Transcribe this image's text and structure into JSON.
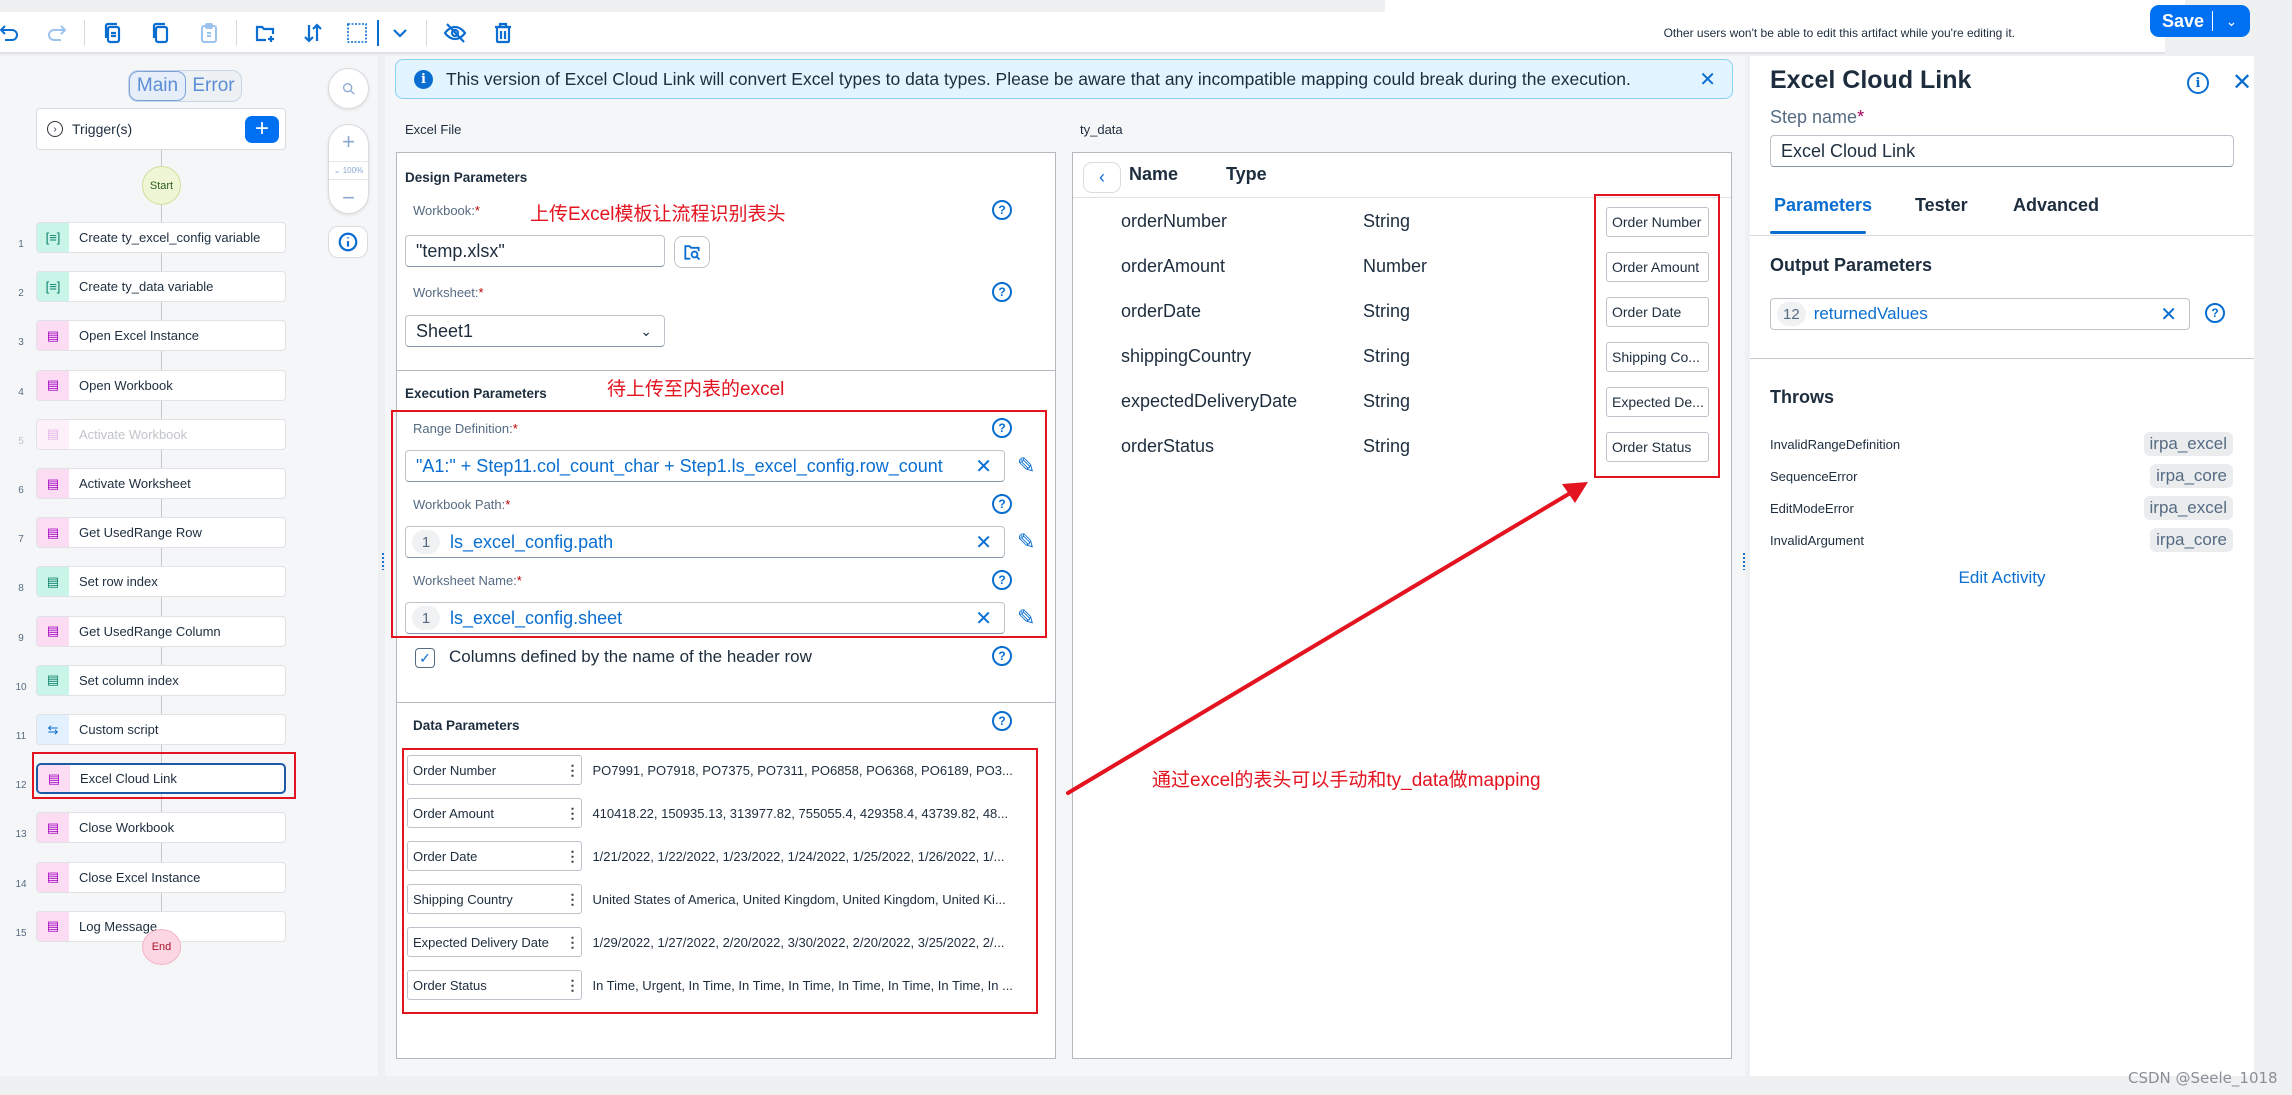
{
  "toolbar": {
    "icons": [
      "undo-icon",
      "redo-icon",
      "copy-icon",
      "duplicate-icon",
      "paste-icon",
      "add-folder-icon",
      "sort-icon",
      "select-area-icon",
      "chevron-down-icon",
      "hide-icon",
      "delete-icon"
    ],
    "lock_note": "Other users won't be able to edit this artifact while you're editing it.",
    "save_label": "Save"
  },
  "flow": {
    "tabs": [
      "Main",
      "Error"
    ],
    "trigger_label": "Trigger(s)",
    "start_label": "Start",
    "end_label": "End",
    "zoom_level": "100%",
    "steps": [
      {
        "num": "1",
        "label": "Create ty_excel_config variable",
        "kind": "mint",
        "icon": "[≡]"
      },
      {
        "num": "2",
        "label": "Create ty_data variable",
        "kind": "mint",
        "icon": "[≡]"
      },
      {
        "num": "3",
        "label": "Open Excel Instance",
        "kind": "pink",
        "icon": "📋"
      },
      {
        "num": "4",
        "label": "Open Workbook",
        "kind": "pink",
        "icon": "📋"
      },
      {
        "num": "5",
        "label": "Activate Workbook",
        "kind": "pink",
        "icon": "📋",
        "disabled": true
      },
      {
        "num": "6",
        "label": "Activate Worksheet",
        "kind": "pink",
        "icon": "📋"
      },
      {
        "num": "7",
        "label": "Get UsedRange Row",
        "kind": "pink",
        "icon": "📋"
      },
      {
        "num": "8",
        "label": "Set row index",
        "kind": "mint",
        "icon": "📋"
      },
      {
        "num": "9",
        "label": "Get UsedRange Column",
        "kind": "pink",
        "icon": "📋"
      },
      {
        "num": "10",
        "label": "Set column index",
        "kind": "mint",
        "icon": "📋"
      },
      {
        "num": "11",
        "label": "Custom script",
        "kind": "blue",
        "icon": "⇆"
      },
      {
        "num": "12",
        "label": "Excel Cloud Link",
        "kind": "pink",
        "icon": "📋",
        "selected": true
      },
      {
        "num": "13",
        "label": "Close Workbook",
        "kind": "pink",
        "icon": "📋"
      },
      {
        "num": "14",
        "label": "Close Excel Instance",
        "kind": "pink",
        "icon": "📋"
      },
      {
        "num": "15",
        "label": "Log Message",
        "kind": "pink",
        "icon": "📋"
      }
    ]
  },
  "banner": {
    "text": "This version of Excel Cloud Link will convert Excel types to data types. Please be aware that any incompatible mapping could break during the execution."
  },
  "excel_file": {
    "caption": "Excel File",
    "design": {
      "title": "Design Parameters",
      "workbook_label": "Workbook:",
      "workbook_value": "\"temp.xlsx\"",
      "worksheet_label": "Worksheet:",
      "worksheet_value": "Sheet1"
    },
    "execution": {
      "title": "Execution Parameters",
      "range_label": "Range Definition:",
      "range_value": "\"A1:\" + Step11.col_count_char + Step1.ls_excel_config.row_count",
      "path_label": "Workbook Path:",
      "path_step": "1",
      "path_value": "ls_excel_config.path",
      "sheet_label": "Worksheet Name:",
      "sheet_step": "1",
      "sheet_value": "ls_excel_config.sheet",
      "header_checkbox_label": "Columns defined by the name of the header row",
      "header_checkbox_checked": true
    },
    "data": {
      "title": "Data Parameters",
      "rows": [
        {
          "key": "Order Number",
          "value": "PO7991, PO7918, PO7375, PO7311, PO6858, PO6368, PO6189, PO3..."
        },
        {
          "key": "Order Amount",
          "value": "410418.22, 150935.13, 313977.82, 755055.4, 429358.4, 43739.82, 48..."
        },
        {
          "key": "Order Date",
          "value": "1/21/2022, 1/22/2022, 1/23/2022, 1/24/2022, 1/25/2022, 1/26/2022, 1/..."
        },
        {
          "key": "Shipping Country",
          "value": "United States of America, United Kingdom, United Kingdom, United Ki..."
        },
        {
          "key": "Expected Delivery Date",
          "value": "1/29/2022, 1/27/2022, 2/20/2022, 3/30/2022, 2/20/2022, 3/25/2022, 2/..."
        },
        {
          "key": "Order Status",
          "value": "In Time, Urgent, In Time, In Time, In Time, In Time, In Time, In Time, In ..."
        }
      ]
    }
  },
  "ty_data": {
    "caption": "ty_data",
    "col_name": "Name",
    "col_type": "Type",
    "rows": [
      {
        "name": "orderNumber",
        "type": "String",
        "mapped": "Order Number"
      },
      {
        "name": "orderAmount",
        "type": "Number",
        "mapped": "Order Amount"
      },
      {
        "name": "orderDate",
        "type": "String",
        "mapped": "Order Date"
      },
      {
        "name": "shippingCountry",
        "type": "String",
        "mapped": "Shipping Co..."
      },
      {
        "name": "expectedDeliveryDate",
        "type": "String",
        "mapped": "Expected De..."
      },
      {
        "name": "orderStatus",
        "type": "String",
        "mapped": "Order Status"
      }
    ]
  },
  "annotations": {
    "upload_template": "上传Excel模板让流程识别表头",
    "pending_excel": "待上传至内表的excel",
    "mapping_hint": "通过excel的表头可以手动和ty_data做mapping"
  },
  "right_panel": {
    "title": "Excel Cloud Link",
    "step_name_label": "Step name",
    "step_name_value": "Excel Cloud Link",
    "tabs": [
      "Parameters",
      "Tester",
      "Advanced"
    ],
    "active_tab": "Parameters",
    "output_title": "Output Parameters",
    "output_step": "12",
    "output_value": "returnedValues",
    "throws_title": "Throws",
    "throws": [
      {
        "name": "InvalidRangeDefinition",
        "lib": "irpa_excel"
      },
      {
        "name": "SequenceError",
        "lib": "irpa_core"
      },
      {
        "name": "EditModeError",
        "lib": "irpa_excel"
      },
      {
        "name": "InvalidArgument",
        "lib": "irpa_core"
      }
    ],
    "edit_activity": "Edit Activity"
  },
  "watermark": "CSDN @Seele_1018",
  "colors": {
    "accent": "#0a6ed1",
    "save": "#0070f2",
    "annotation_red": "#e3131f"
  }
}
